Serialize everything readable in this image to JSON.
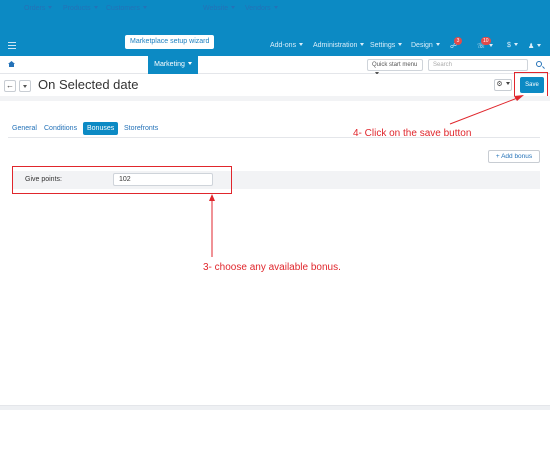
{
  "topbar": {
    "wizard_label": "Marketplace setup wizard",
    "addons_label": "Add-ons",
    "administration_label": "Administration",
    "settings_label": "Settings",
    "design_label": "Design",
    "notifications_count": "3",
    "messages_count": "10",
    "currency_label": "$"
  },
  "nav": {
    "items": [
      "Orders",
      "Products",
      "Customers",
      "Marketing",
      "Website",
      "Vendors"
    ],
    "quick_start_label": "Quick start menu",
    "search_placeholder": "Search"
  },
  "header": {
    "back_glyph": "←",
    "title": "On Selected date",
    "gear_glyph": "⚙",
    "save_label": "Save"
  },
  "tabs": [
    "General",
    "Conditions",
    "Bonuses",
    "Storefronts"
  ],
  "bonuses": {
    "add_bonus_label": "+ Add bonus",
    "row_label": "Give points:",
    "row_value": "102"
  },
  "annotations": {
    "step4": "4- Click on the save button",
    "step3": "3- choose any available bonus."
  },
  "colors": {
    "accent": "#0c8ac4",
    "link": "#2472b8",
    "annotation_red": "#e0262c"
  }
}
